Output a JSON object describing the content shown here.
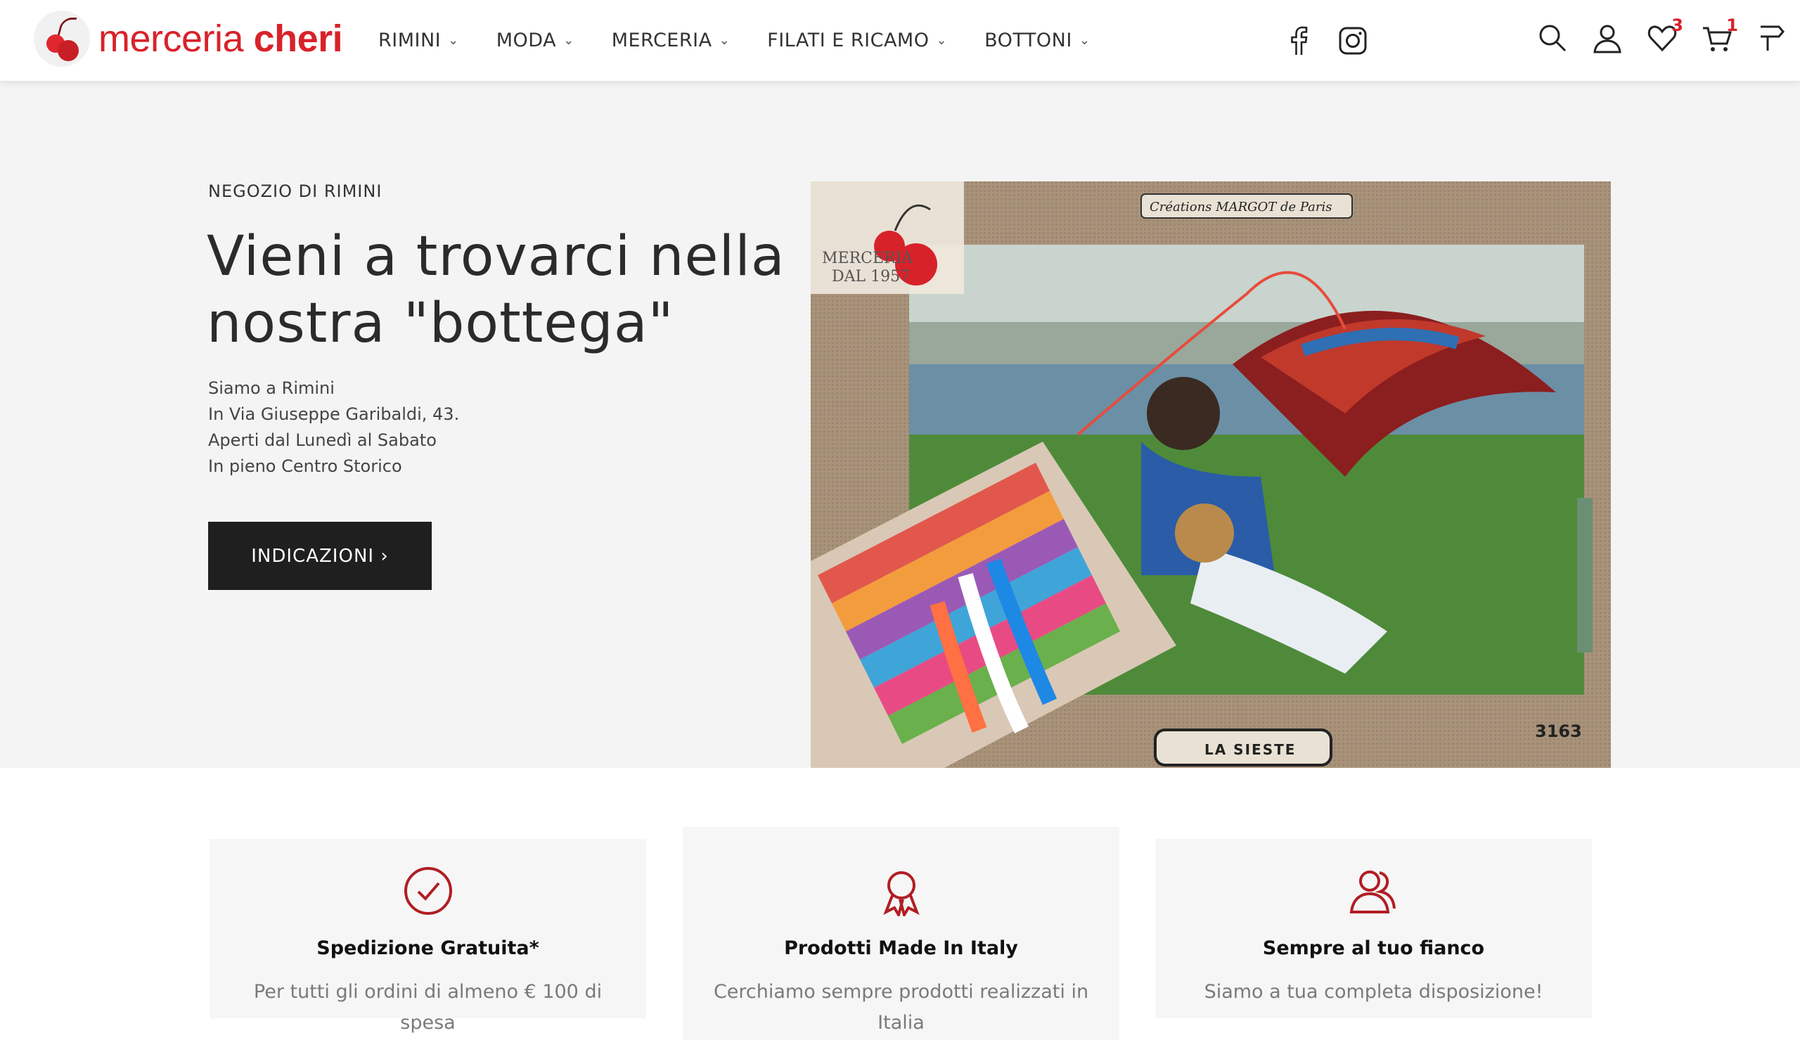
{
  "brand": {
    "name_light": "merceria",
    "name_bold": "cheri",
    "color": "#d8222a"
  },
  "nav": {
    "items": [
      {
        "label": "RIMINI"
      },
      {
        "label": "MODA"
      },
      {
        "label": "MERCERIA"
      },
      {
        "label": "FILATI E RICAMO"
      },
      {
        "label": "BOTTONI"
      }
    ]
  },
  "icons": {
    "social": [
      "facebook-icon",
      "instagram-icon"
    ],
    "utils": [
      "search-icon",
      "user-icon",
      "heart-icon",
      "cart-icon",
      "flag-icon"
    ]
  },
  "wishlist": {
    "count": "3"
  },
  "cart": {
    "count": "1"
  },
  "hero": {
    "eyebrow": "NEGOZIO DI RIMINI",
    "title": "Vieni a trovarci nella nostra \"bottega\"",
    "lines": [
      "Siamo a Rimini",
      "In Via Giuseppe Garibaldi, 43.",
      "Aperti dal Lunedì al Sabato",
      "In pieno Centro Storico"
    ],
    "cta": "INDICAZIONI ›",
    "image": {
      "stamp_line1": "MERCERIA",
      "stamp_line2": "DAL 1957",
      "banner": "Créations MARGOT de Paris",
      "plaque": "LA SIESTE",
      "code": "3163"
    }
  },
  "features": [
    {
      "title": "Spedizione Gratuita*",
      "desc": "Per tutti gli ordini di almeno € 100 di spesa",
      "icon": "check-circle-icon"
    },
    {
      "title": "Prodotti Made In Italy",
      "desc": "Cerchiamo sempre prodotti realizzati in Italia",
      "icon": "award-ribbon-icon"
    },
    {
      "title": "Sempre al tuo fianco",
      "desc": "Siamo a tua completa disposizione!",
      "icon": "users-icon"
    }
  ],
  "colors": {
    "accent": "#d8222a",
    "dark_button": "#1f1f1f",
    "hero_bg": "#f4f4f4"
  }
}
